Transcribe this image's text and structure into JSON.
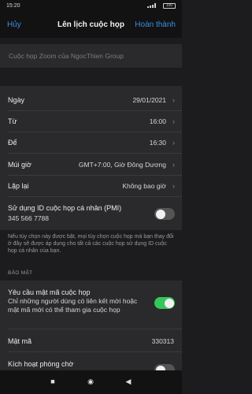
{
  "status": {
    "time": "15:20",
    "battery": "100"
  },
  "nav": {
    "cancel": "Hủy",
    "title": "Lên lịch cuộc họp",
    "done": "Hoàn thành"
  },
  "topic": {
    "placeholder": "Cuộc họp Zoom của NgocThien Group"
  },
  "schedule": {
    "date_label": "Ngày",
    "date_value": "29/01/2021",
    "from_label": "Từ",
    "from_value": "16:00",
    "to_label": "Để",
    "to_value": "16:30",
    "tz_label": "Múi giờ",
    "tz_value": "GMT+7:00, Giờ Đông Dương",
    "repeat_label": "Lặp lại",
    "repeat_value": "Không bao giờ",
    "pmi_label": "Sử dụng ID cuộc họp cá nhân (PMI)",
    "pmi_value": "345 566 7788",
    "pmi_enabled": false
  },
  "note": "Nếu tùy chọn này được bật, mọi tùy chọn cuộc họp mà bạn thay đổi ở đây sẽ được áp dụng cho tất cả các cuộc họp sử dụng ID cuộc họp cá nhân của bạn.",
  "security": {
    "header": "BẢO MẬT",
    "require_pwd_label": "Yêu cầu mật mã cuộc họp",
    "require_pwd_desc": "Chỉ những người dùng có liên kết mời hoặc mật mã mới có thể tham gia cuộc họp",
    "require_pwd_enabled": true,
    "password_label": "Mật mã",
    "password_value": "330313",
    "waiting_room_label": "Kích hoạt phòng chờ",
    "waiting_room_enabled": false
  },
  "colors": {
    "accent": "#3a8ee6",
    "toggle_on": "#35c759"
  }
}
